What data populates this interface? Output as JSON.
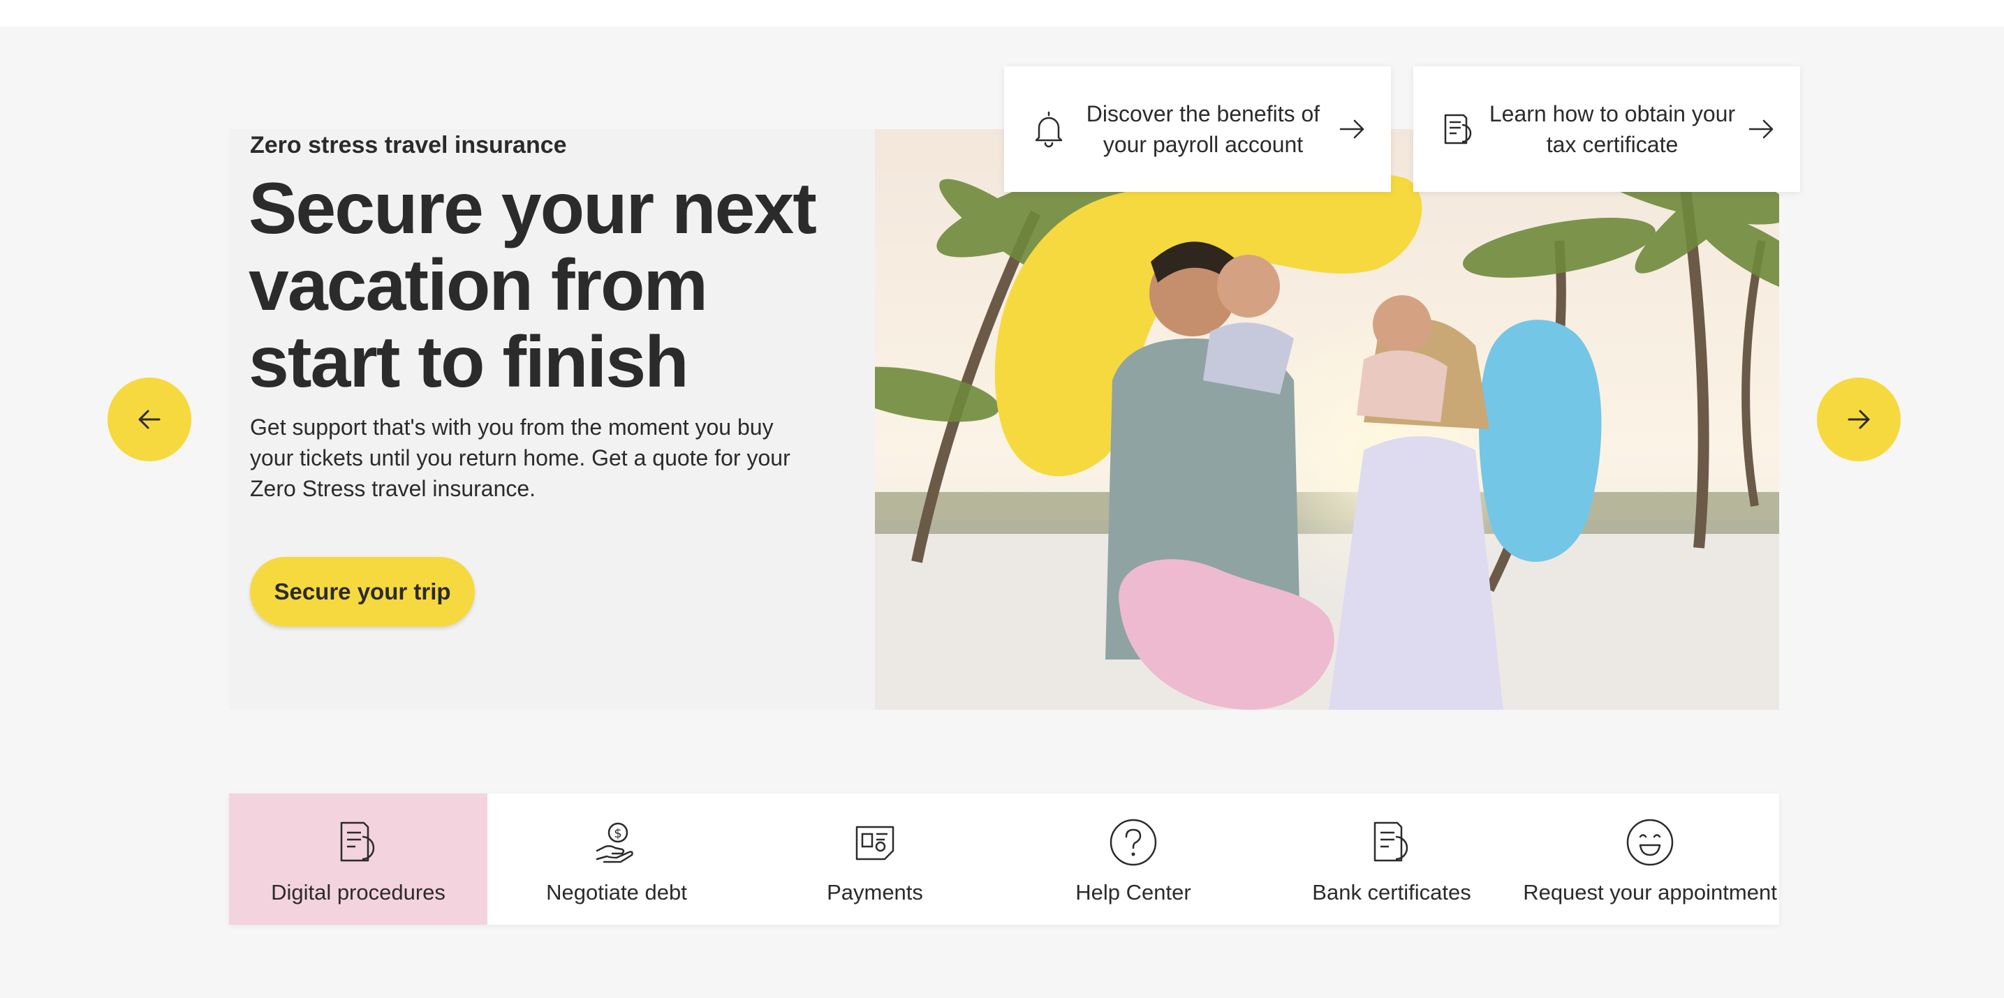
{
  "hero": {
    "eyebrow": "Zero stress travel insurance",
    "headline": "Secure your next vacation from start to finish",
    "description": "Get support that's with you from the moment you buy your tickets until you return home. Get a quote for your Zero Stress travel insurance.",
    "cta_label": "Secure your trip",
    "image_icon": "beach-family-photo"
  },
  "carousel": {
    "prev_icon": "arrow-left-icon",
    "next_icon": "arrow-right-icon"
  },
  "promos": [
    {
      "icon": "bell-icon",
      "text": "Discover the benefits of your payroll account",
      "arrow_icon": "arrow-right-icon"
    },
    {
      "icon": "document-icon",
      "text": "Learn how to obtain your tax certificate",
      "arrow_icon": "arrow-right-icon"
    }
  ],
  "quick_links": [
    {
      "label": "Digital procedures",
      "icon": "document-icon",
      "active": true
    },
    {
      "label": "Negotiate debt",
      "icon": "hand-coin-icon",
      "active": false
    },
    {
      "label": "Payments",
      "icon": "payment-card-icon",
      "active": false
    },
    {
      "label": "Help Center",
      "icon": "question-circle-icon",
      "active": false
    },
    {
      "label": "Bank certificates",
      "icon": "document-icon",
      "active": false
    },
    {
      "label": "Request your appointment",
      "icon": "smile-face-icon",
      "active": false
    }
  ],
  "colors": {
    "accent_yellow": "#f6d93f",
    "active_pink": "#f3d3de",
    "blob_blue": "#74c6e6",
    "blob_pink": "#eebad0",
    "text_dark": "#2b2b2b",
    "page_bg": "#f6f6f6"
  }
}
